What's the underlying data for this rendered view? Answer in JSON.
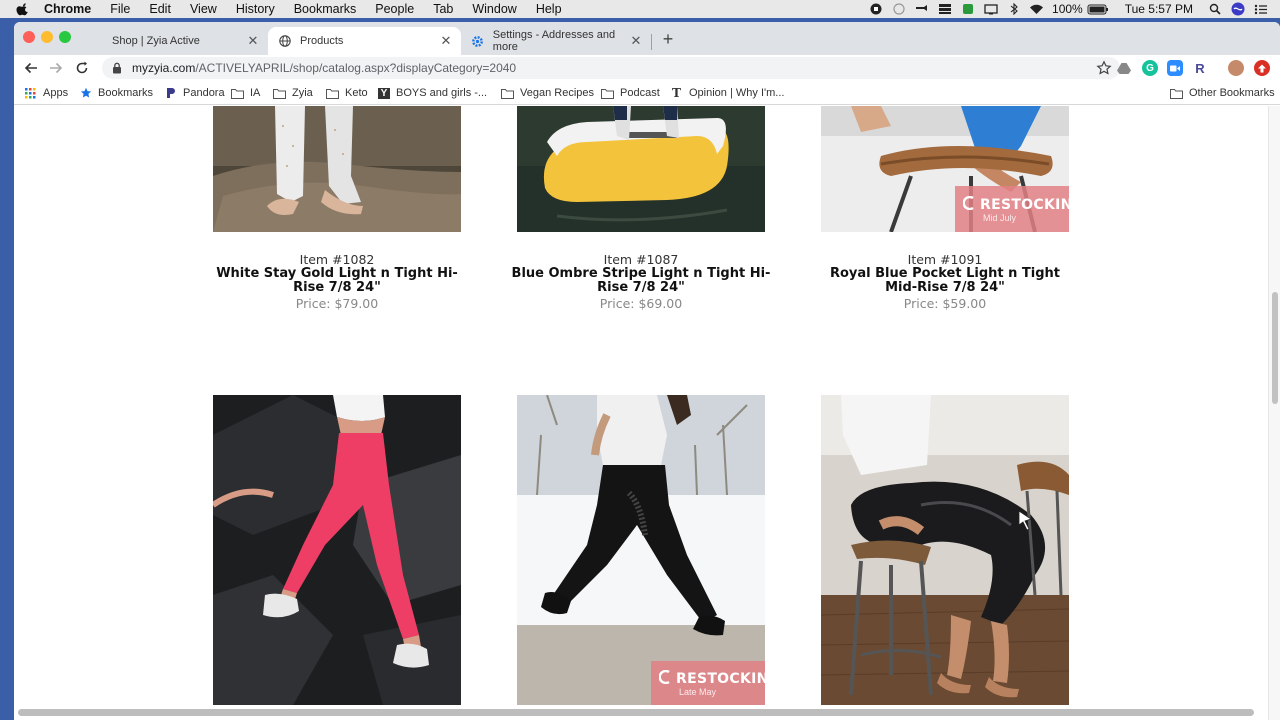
{
  "menubar": {
    "app": "Chrome",
    "items": [
      "File",
      "Edit",
      "View",
      "History",
      "Bookmarks",
      "People",
      "Tab",
      "Window",
      "Help"
    ],
    "battery": "100%",
    "clock": "Tue 5:57 PM"
  },
  "tabs": [
    {
      "title": "Shop | Zyia Active",
      "icon": "zyia-logo-icon",
      "active": false
    },
    {
      "title": "Products",
      "icon": "globe-icon",
      "active": true
    },
    {
      "title": "Settings - Addresses and more",
      "icon": "settings-gear-icon",
      "active": false
    }
  ],
  "address": {
    "host": "myzyia.com",
    "path": "/ACTIVELYAPRIL/shop/catalog.aspx?displayCategory=2040"
  },
  "bookmarks": [
    {
      "label": "Apps",
      "icon": "apps-grid-icon"
    },
    {
      "label": "Bookmarks",
      "icon": "star-icon"
    },
    {
      "label": "Pandora",
      "icon": "pandora-icon"
    },
    {
      "label": "IA",
      "icon": "folder-icon"
    },
    {
      "label": "Zyia",
      "icon": "folder-icon"
    },
    {
      "label": "Keto",
      "icon": "folder-icon"
    },
    {
      "label": "BOYS and girls -...",
      "icon": "yahoo-icon"
    },
    {
      "label": "Vegan Recipes",
      "icon": "folder-icon"
    },
    {
      "label": "Podcast",
      "icon": "folder-icon"
    },
    {
      "label": "Opinion | Why I'm...",
      "icon": "nyt-icon"
    },
    {
      "label": "Other Bookmarks",
      "icon": "folder-icon"
    }
  ],
  "products": [
    {
      "item": "Item #1082",
      "name": "White Stay Gold Light n Tight Hi-Rise 7/8 24\"",
      "price": "Price: $79.00"
    },
    {
      "item": "Item #1087",
      "name": "Blue Ombre Stripe Light n Tight Hi-Rise 7/8 24\"",
      "price": "Price: $69.00"
    },
    {
      "item": "Item #1091",
      "name": "Royal Blue Pocket Light n Tight Mid-Rise 7/8 24\"",
      "price": "Price: $59.00"
    }
  ],
  "badges": [
    {
      "title": "RESTOCKING",
      "sub": "Mid July"
    },
    {
      "title": "RESTOCKING",
      "sub": "Late May"
    }
  ],
  "colors": {
    "accent_blue": "#1a73e8",
    "restock_pink": "#e28085"
  }
}
